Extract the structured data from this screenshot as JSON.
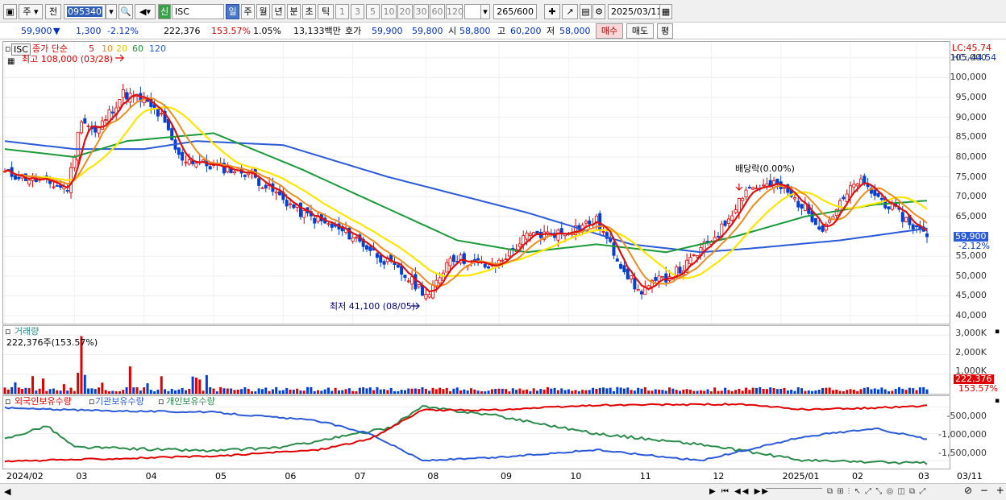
{
  "toolbar": {
    "market_select": "주",
    "prev_label": "전",
    "code_value": "095340",
    "shin_label": "신",
    "stock_name": "ISC",
    "period_tabs": [
      "일",
      "주",
      "월",
      "년",
      "분",
      "초",
      "틱"
    ],
    "selected_period": "일",
    "multipliers": [
      "1",
      "3",
      "5",
      "10",
      "20",
      "30",
      "60",
      "120"
    ],
    "count_value": "265",
    "count_total": "/600",
    "date_value": "2025/03/11"
  },
  "quote": {
    "price": "59,900",
    "change_arrow": "▼",
    "change": "1,300",
    "change_rate": "-2.12%",
    "volume": "222,376",
    "volume_rate": "153.57%",
    "turnover_rate": "1.05%",
    "amount": "13,133백만",
    "bid_label": "호가",
    "ask_price": "59,900",
    "bid_price": "59,800",
    "open_label": "시",
    "open": "58,800",
    "high_label": "고",
    "high": "60,200",
    "low_label": "저",
    "low": "58,000",
    "buy_label": "매수",
    "sell_label": "매도",
    "eval_label": "평"
  },
  "price_panel": {
    "name_tag": "ISC",
    "ma_title": "종가 단순",
    "ma_periods": [
      "5",
      "10",
      "20",
      "60",
      "120"
    ],
    "high_note": "최고 108,000 (03/28)",
    "low_note": "최저 41,100 (08/05)",
    "dividend_note": "배당락(0.00%)",
    "lc": "LC:45.74",
    "hc": "HC:-44.54",
    "y_ticks": [
      "105,000",
      "100,000",
      "95,000",
      "90,000",
      "85,000",
      "80,000",
      "75,000",
      "70,000",
      "65,000",
      "60,000",
      "55,000",
      "50,000",
      "45,000",
      "40,000"
    ],
    "current_tag": "59,900",
    "current_rate_tag": "-2.12%"
  },
  "volume_panel": {
    "title": "거래량",
    "value_note": "222,376주(153.57%)",
    "y_ticks": [
      "3,000K",
      "2,000K",
      "1,000K"
    ],
    "current_tag": "222,376",
    "current_rate_tag": "153.57%"
  },
  "holdings_panel": {
    "legend": [
      "외국인보유수량",
      "기관보유수량",
      "개인보유수량"
    ],
    "y_ticks": [
      "-500,000",
      "-1,000,000",
      "-1,500,000"
    ]
  },
  "x_axis": [
    "2024/02",
    "03",
    "04",
    "05",
    "06",
    "07",
    "08",
    "09",
    "10",
    "11",
    "12",
    "2025/01",
    "02",
    "03"
  ],
  "x_axis_end": "03/11",
  "colors": {
    "ma5": "#e01010",
    "ma10": "#f08c1e",
    "ma20": "#ffe600",
    "ma60": "#1a9a3a",
    "ma120": "#2a5ad8",
    "up": "#e00000",
    "down": "#0040d0",
    "foreign": "#e00000",
    "institution": "#2a5ad8",
    "individual": "#2a8a4a"
  },
  "chart_data": {
    "type": "candlestick",
    "x_range": [
      "2024/02",
      "2025/03/11"
    ],
    "ylim": [
      38000,
      109000
    ],
    "ma_anchors": {
      "ma120": [
        [
          0,
          84000
        ],
        [
          20,
          82000
        ],
        [
          40,
          82000
        ],
        [
          55,
          84000
        ],
        [
          80,
          83000
        ],
        [
          110,
          75000
        ],
        [
          150,
          66000
        ],
        [
          180,
          58000
        ],
        [
          200,
          56000
        ],
        [
          215,
          57000
        ],
        [
          240,
          59000
        ],
        [
          265,
          62000
        ]
      ],
      "ma60": [
        [
          0,
          82000
        ],
        [
          20,
          80000
        ],
        [
          35,
          84000
        ],
        [
          60,
          86000
        ],
        [
          85,
          77000
        ],
        [
          110,
          67000
        ],
        [
          130,
          59000
        ],
        [
          150,
          56000
        ],
        [
          170,
          58000
        ],
        [
          190,
          56000
        ],
        [
          210,
          60000
        ],
        [
          230,
          65000
        ],
        [
          250,
          68000
        ],
        [
          265,
          69000
        ]
      ]
    },
    "close_anchors": [
      [
        0,
        76000
      ],
      [
        10,
        74000
      ],
      [
        18,
        72000
      ],
      [
        22,
        90000
      ],
      [
        26,
        86000
      ],
      [
        34,
        96000
      ],
      [
        40,
        94000
      ],
      [
        45,
        90000
      ],
      [
        50,
        80000
      ],
      [
        58,
        78000
      ],
      [
        70,
        76000
      ],
      [
        85,
        66000
      ],
      [
        100,
        60000
      ],
      [
        115,
        50000
      ],
      [
        122,
        45000
      ],
      [
        128,
        55000
      ],
      [
        140,
        52000
      ],
      [
        150,
        60000
      ],
      [
        160,
        61000
      ],
      [
        170,
        64000
      ],
      [
        175,
        56000
      ],
      [
        182,
        46000
      ],
      [
        195,
        52000
      ],
      [
        206,
        62000
      ],
      [
        213,
        72000
      ],
      [
        222,
        73000
      ],
      [
        230,
        67000
      ],
      [
        235,
        62000
      ],
      [
        245,
        74000
      ],
      [
        255,
        67000
      ],
      [
        262,
        62000
      ],
      [
        265,
        59900
      ]
    ],
    "holdings": {
      "foreign": [
        [
          0,
          -1520000
        ],
        [
          20,
          -1480000
        ],
        [
          60,
          -1420000
        ],
        [
          90,
          -1300000
        ],
        [
          105,
          -1100000
        ],
        [
          120,
          -560000
        ],
        [
          140,
          -560000
        ],
        [
          170,
          -470000
        ],
        [
          210,
          -450000
        ],
        [
          230,
          -550000
        ],
        [
          250,
          -520000
        ],
        [
          265,
          -480000
        ]
      ],
      "institution": [
        [
          0,
          -520000
        ],
        [
          20,
          -560000
        ],
        [
          60,
          -600000
        ],
        [
          90,
          -760000
        ],
        [
          105,
          -1000000
        ],
        [
          120,
          -1500000
        ],
        [
          140,
          -1450000
        ],
        [
          170,
          -1300000
        ],
        [
          200,
          -1500000
        ],
        [
          230,
          -1050000
        ],
        [
          250,
          -900000
        ],
        [
          265,
          -1100000
        ]
      ],
      "individual": [
        [
          0,
          -1100000
        ],
        [
          12,
          -850000
        ],
        [
          20,
          -1250000
        ],
        [
          60,
          -1320000
        ],
        [
          80,
          -1250000
        ],
        [
          110,
          -900000
        ],
        [
          120,
          -500000
        ],
        [
          140,
          -650000
        ],
        [
          170,
          -1000000
        ],
        [
          200,
          -1200000
        ],
        [
          230,
          -1500000
        ],
        [
          265,
          -1550000
        ]
      ]
    }
  }
}
